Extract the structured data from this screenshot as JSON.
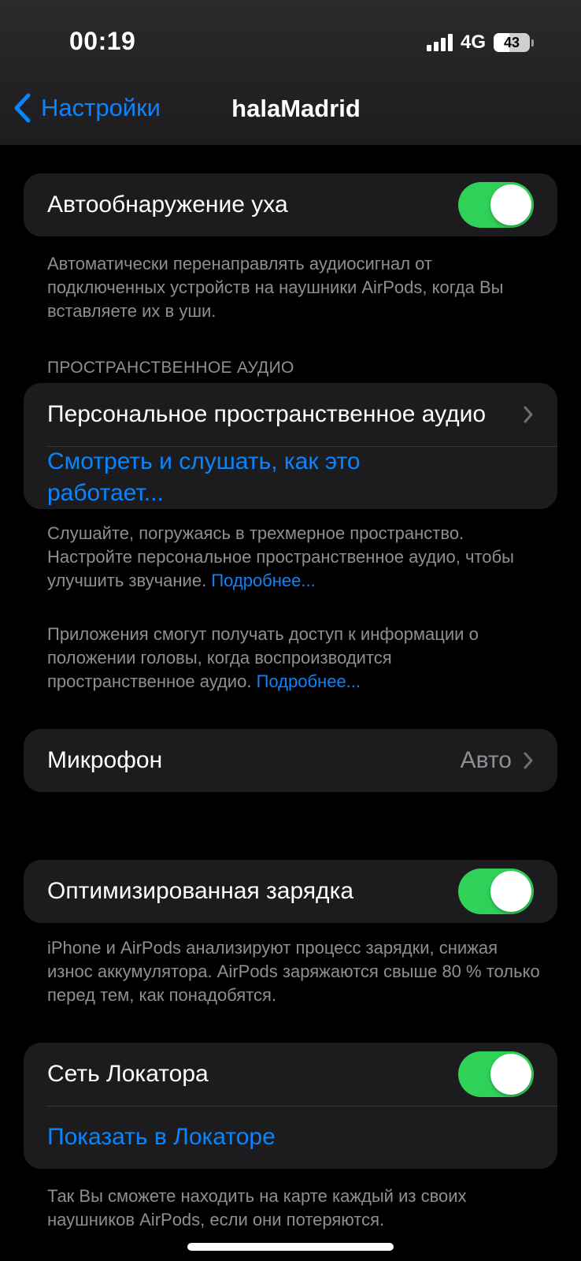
{
  "status_bar": {
    "time": "00:19",
    "network": "4G",
    "battery": "43",
    "battery_level": 0.43
  },
  "nav": {
    "back_label": "Настройки",
    "title": "halaMadrid"
  },
  "ear_detection": {
    "label": "Автообнаружение уха",
    "enabled": true,
    "footnote": "Автоматически перенаправлять аудиосигнал от подключенных устройств на наушники AirPods, когда Вы вставляете их в уши."
  },
  "spatial_audio": {
    "header": "ПРОСТРАНСТВЕННОЕ АУДИО",
    "personal_label": "Персональное пространственное аудио",
    "how_it_works_link": "Смотреть и слушать, как это работает...",
    "footnote1": "Слушайте, погружаясь в трехмерное пространство. Настройте персональное пространственное аудио, чтобы улучшить звучание.",
    "footnote1_link": "Подробнее...",
    "footnote2": "Приложения смогут получать доступ к информации о положении головы, когда воспроизводится пространственное аудио.",
    "footnote2_link": "Подробнее..."
  },
  "microphone": {
    "label": "Микрофон",
    "value": "Авто"
  },
  "optimized_charging": {
    "label": "Оптимизированная зарядка",
    "enabled": true,
    "footnote": "iPhone и AirPods анализируют процесс зарядки, снижая износ аккумулятора. AirPods заряжаются свыше 80 % только перед тем, как понадобятся."
  },
  "find_my": {
    "label": "Сеть Локатора",
    "enabled": true,
    "show_link": "Показать в Локаторе",
    "footnote": "Так Вы сможете находить на карте каждый из своих наушников AirPods, если они потеряются."
  },
  "colors": {
    "accent": "#0a84ff",
    "toggle_on": "#30d158",
    "cell_bg": "#1c1c1e",
    "secondary_text": "#8e8e93"
  }
}
